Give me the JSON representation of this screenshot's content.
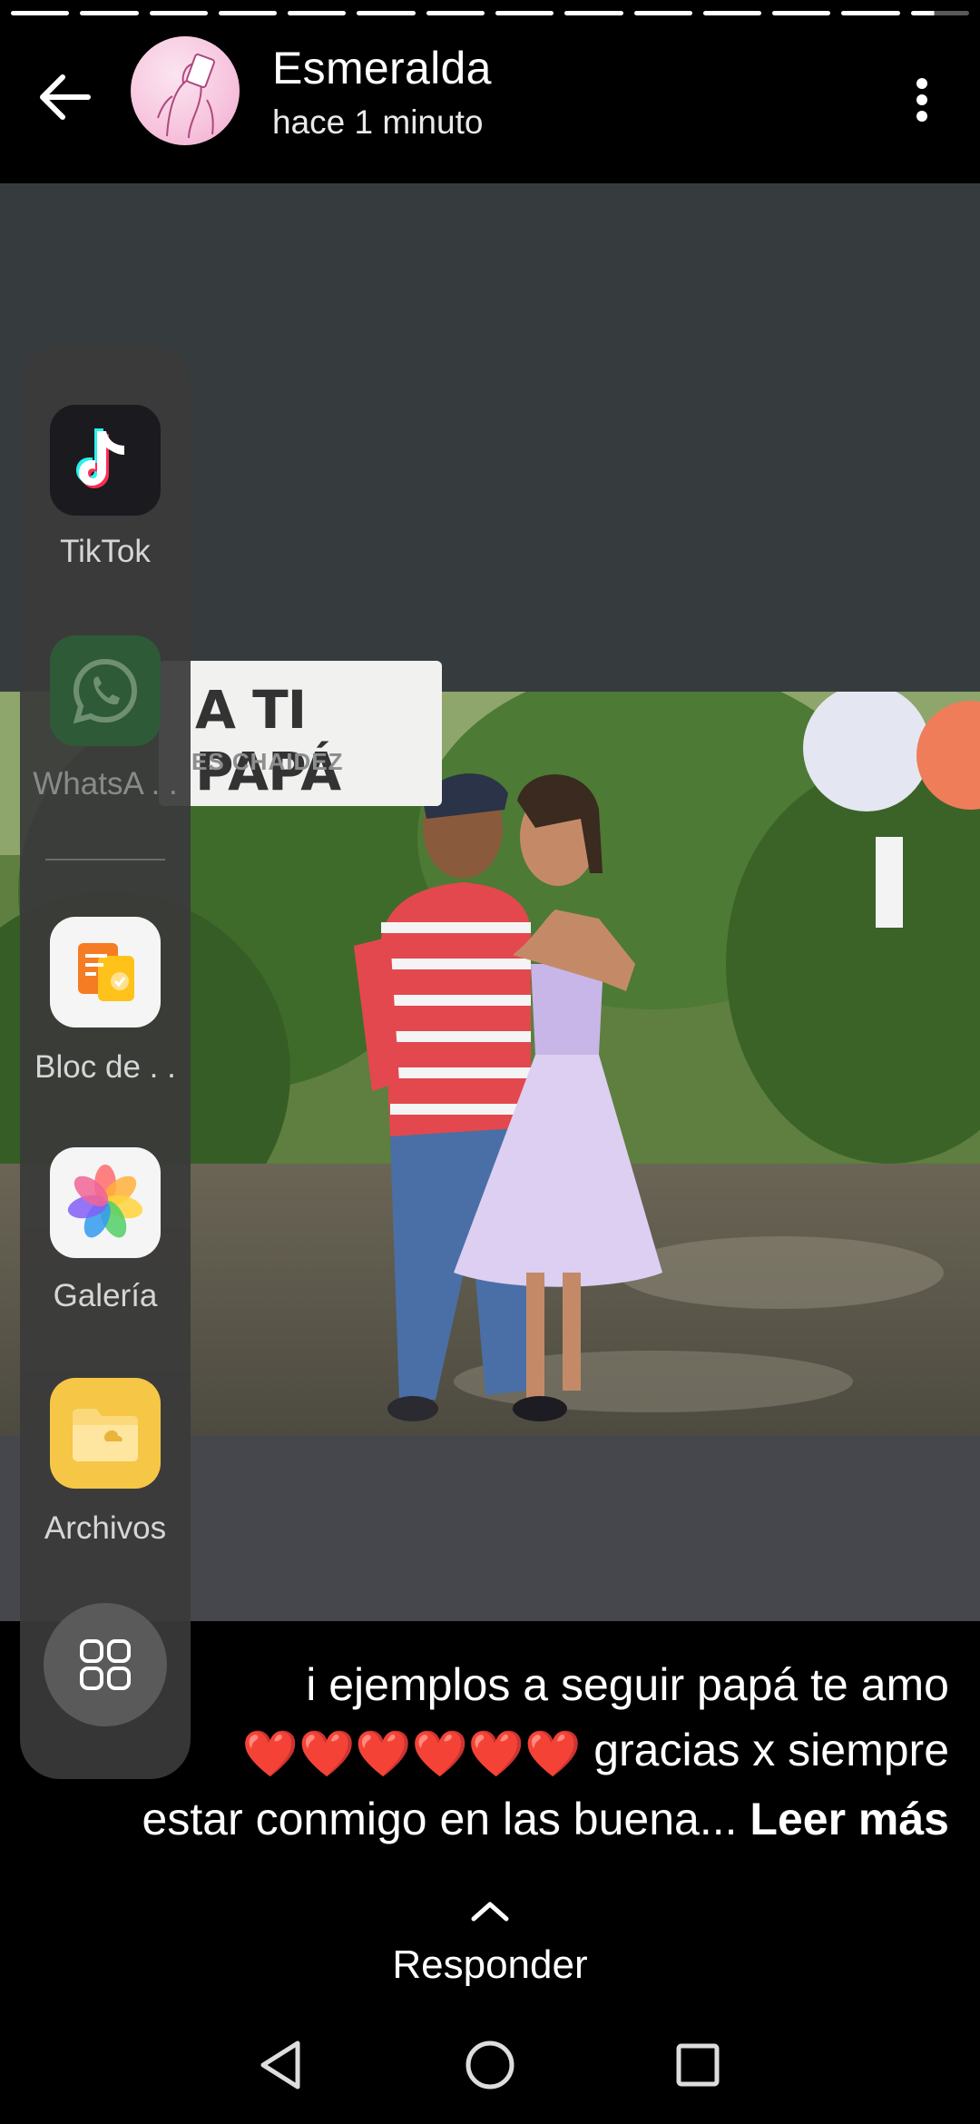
{
  "story": {
    "progress_segments": 14,
    "author": "Esmeralda",
    "time": "hace 1 minuto",
    "banner_title": "A TI PAPÁ",
    "banner_subtitle": "ES CHAIDEZ",
    "caption_line1": "i ejemplos a seguir papá te amo",
    "caption_line2": "gracias x siempre",
    "caption_line3": "estar conmigo en las buena...",
    "read_more": "Leer más",
    "hearts": "❤️❤️❤️❤️❤️❤️",
    "reply_label": "Responder"
  },
  "dock": {
    "apps": [
      {
        "label": "TikTok",
        "icon": "tiktok-icon"
      },
      {
        "label": "WhatsA . .",
        "icon": "whatsapp-icon"
      },
      {
        "label": "Bloc de . .",
        "icon": "notes-icon"
      },
      {
        "label": "Galería",
        "icon": "gallery-icon"
      },
      {
        "label": "Archivos",
        "icon": "files-icon"
      }
    ],
    "all_apps_icon": "grid-icon"
  },
  "colors": {
    "story_bg": "#363c3e",
    "dock_bg": "#3a3a3a",
    "whatsapp": "#2e5a38",
    "files": "#f6c646"
  }
}
